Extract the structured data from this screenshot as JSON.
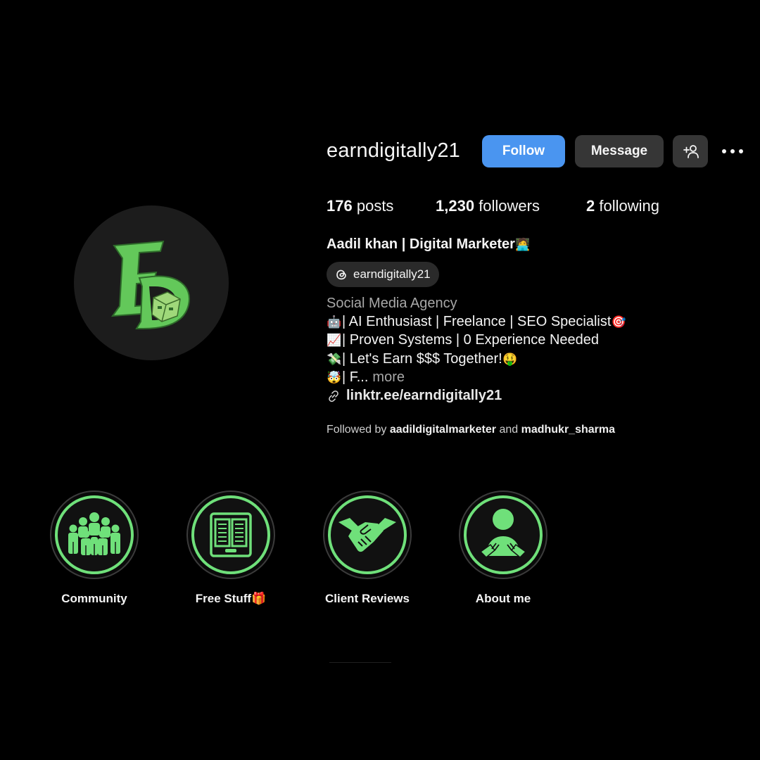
{
  "profile": {
    "username": "earndigitally21",
    "follow_label": "Follow",
    "message_label": "Message",
    "posts_count": "176",
    "posts_label": "posts",
    "followers_count": "1,230",
    "followers_label": "followers",
    "following_count": "2",
    "following_label": "following",
    "full_name": "Aadil khan | Digital Marketer",
    "full_name_emoji": "🧑‍💻",
    "threads_handle": "earndigitally21",
    "category": "Social Media Agency",
    "bio_lines": [
      {
        "emoji": "🤖",
        "text": "| AI Enthusiast | Freelance | SEO Specialist",
        "emoji_end": "🎯"
      },
      {
        "emoji": "📈",
        "text": "| Proven Systems | 0 Experience Needed",
        "emoji_end": ""
      },
      {
        "emoji": "💸",
        "text": "| Let's Earn $$$ Together!",
        "emoji_end": "🤑"
      },
      {
        "emoji": "🤯",
        "text": "| F...",
        "emoji_end": ""
      }
    ],
    "more_label": "more",
    "link": "linktr.ee/earndigitally21",
    "followed_by_prefix": "Followed by",
    "followed_by_1": "aadildigitalmarketer",
    "followed_by_and": "and",
    "followed_by_2": "madhukr_sharma"
  },
  "highlights": [
    {
      "label": "Community",
      "icon": "community-icon"
    },
    {
      "label": "Free Stuff🎁",
      "icon": "free-stuff-icon"
    },
    {
      "label": "Client Reviews",
      "icon": "handshake-icon"
    },
    {
      "label": "About me",
      "icon": "person-icon"
    }
  ],
  "colors": {
    "background": "#000000",
    "follow_button": "#4a95f0",
    "secondary_button": "#363636",
    "accent_green": "#6fe07a"
  }
}
